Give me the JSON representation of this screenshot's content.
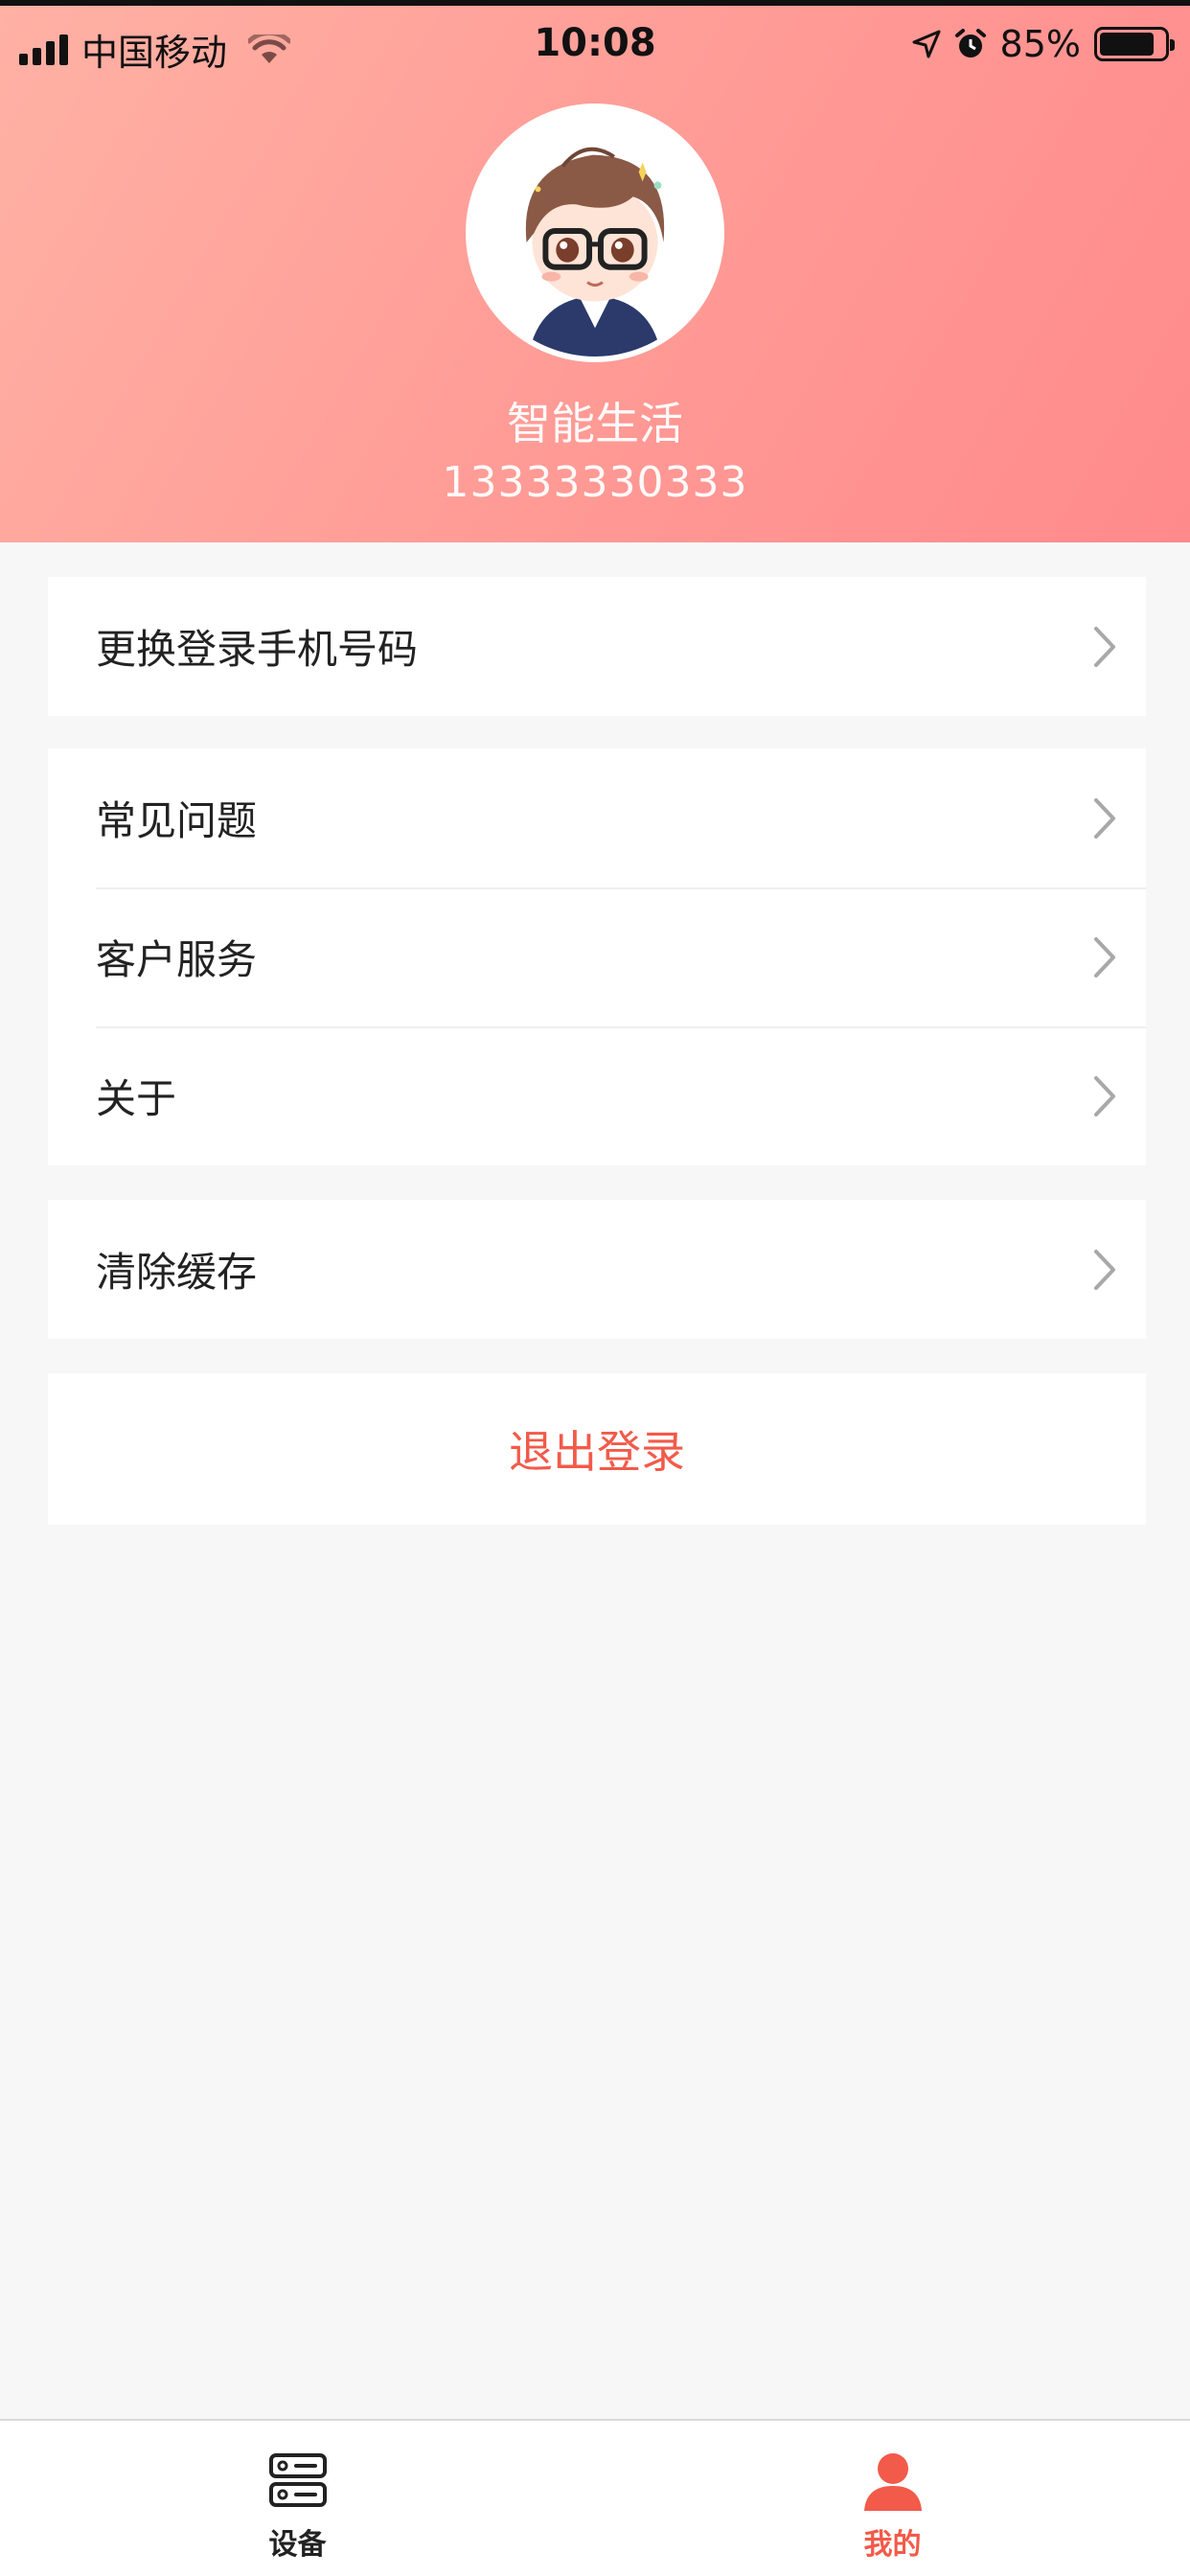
{
  "status_bar": {
    "carrier": "中国移动",
    "time": "10:08",
    "battery": "85%",
    "battery_level": 0.85
  },
  "profile": {
    "name": "智能生活",
    "phone": "13333330333"
  },
  "groups": [
    {
      "items": [
        {
          "label": "更换登录手机号码"
        }
      ]
    },
    {
      "items": [
        {
          "label": "常见问题"
        },
        {
          "label": "客户服务"
        },
        {
          "label": "关于"
        }
      ]
    },
    {
      "items": [
        {
          "label": "清除缓存"
        }
      ]
    }
  ],
  "logout_label": "退出登录",
  "tabbar": {
    "tabs": [
      {
        "label": "设备",
        "icon": "device-icon",
        "active": false
      },
      {
        "label": "我的",
        "icon": "user-icon",
        "active": true
      }
    ]
  },
  "colors": {
    "accent": "#f25a4a",
    "header_start": "#ffb1a4",
    "header_end": "#ff8a8c",
    "tab_inactive": "#222222"
  }
}
